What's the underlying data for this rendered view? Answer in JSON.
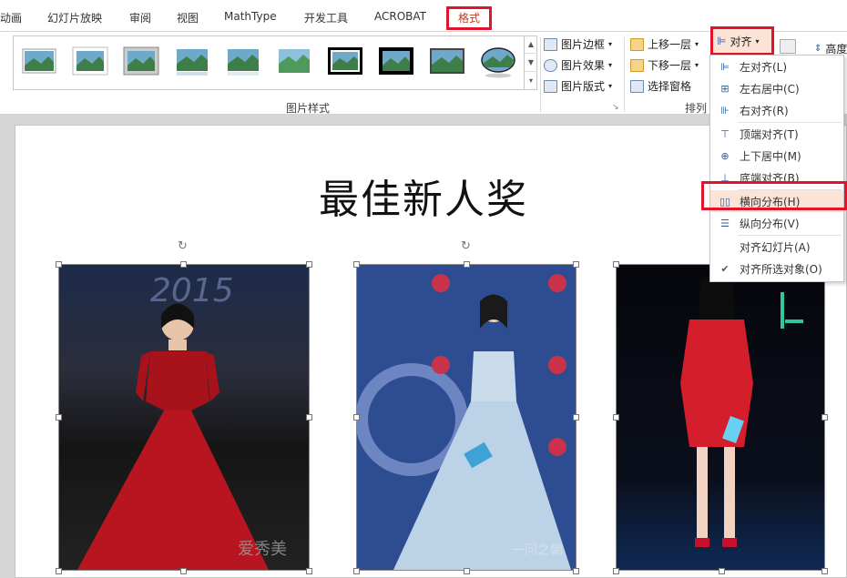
{
  "tabs": [
    "动画",
    "幻灯片放映",
    "审阅",
    "视图",
    "MathType",
    "开发工具",
    "ACROBAT"
  ],
  "active_tab": "格式",
  "ribbon": {
    "picture_border": "图片边框",
    "picture_effects": "图片效果",
    "picture_layout": "图片版式",
    "group_picture_styles": "图片样式",
    "bring_forward": "上移一层",
    "send_backward": "下移一层",
    "selection_pane": "选择窗格",
    "group_arrange": "排列",
    "align": "对齐",
    "height_label": "高度"
  },
  "align_menu": [
    {
      "label": "左对齐(L)",
      "icon": "⊫"
    },
    {
      "label": "左右居中(C)",
      "icon": "⊞"
    },
    {
      "label": "右对齐(R)",
      "icon": "⊪"
    },
    {
      "label": "顶端对齐(T)",
      "icon": "⊤"
    },
    {
      "label": "上下居中(M)",
      "icon": "⊕"
    },
    {
      "label": "底端对齐(B)",
      "icon": "⊥"
    },
    {
      "label": "横向分布(H)",
      "icon": "▯▯"
    },
    {
      "label": "纵向分布(V)",
      "icon": "☰"
    },
    {
      "label": "对齐幻灯片(A)",
      "icon": ""
    },
    {
      "label": "对齐所选对象(O)",
      "icon": "✔"
    }
  ],
  "slide": {
    "title": "最佳新人奖",
    "watermark1": "爱秀美",
    "watermark2": "一问之朝"
  },
  "colors": {
    "accent": "#e0142a",
    "highlight": "#fbe3d6"
  }
}
